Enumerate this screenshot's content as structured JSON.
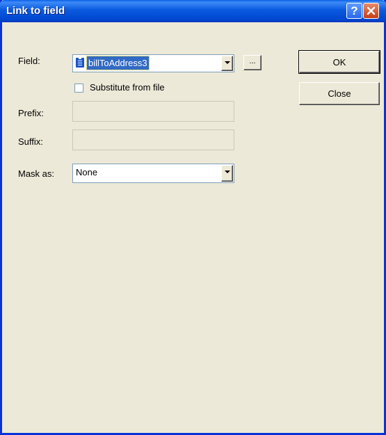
{
  "window": {
    "title": "Link to field"
  },
  "titlebar": {
    "help_glyph": "?",
    "close_icon": "close-icon"
  },
  "form": {
    "field_label": "Field:",
    "field_value": "billToAddress3",
    "browse_label": "...",
    "substitute_label": "Substitute from file",
    "substitute_checked": false,
    "prefix_label": "Prefix:",
    "prefix_value": "",
    "suffix_label": "Suffix:",
    "suffix_value": "",
    "mask_label": "Mask as:",
    "mask_value": "None"
  },
  "buttons": {
    "ok_label": "OK",
    "close_label": "Close"
  },
  "colors": {
    "titlebar": "#0a5ae0",
    "selection": "#316ac5",
    "face": "#ece9d8"
  }
}
